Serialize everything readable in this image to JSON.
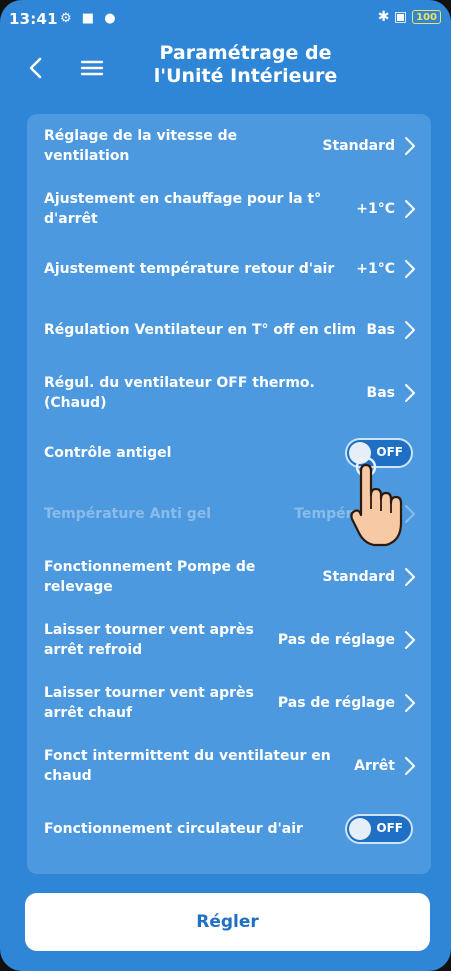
{
  "status": {
    "time": "13:41",
    "left_icons": "⚙ ■ ●",
    "right_icons": "✱ ▣",
    "battery": "100"
  },
  "header": {
    "title_line1": "Paramétrage de",
    "title_line2": "l'Unité Intérieure"
  },
  "rows": [
    {
      "label": "Réglage de la vitesse de ventilation",
      "value": "Standard"
    },
    {
      "label": "Ajustement en chauffage pour la t° d'arrêt",
      "value": "+1°C"
    },
    {
      "label": "Ajustement température retour d'air",
      "value": "+1°C"
    },
    {
      "label": "Régulation Ventilateur en T° off en clim",
      "value": "Bas"
    },
    {
      "label": "Régul. du ventilateur OFF thermo. (Chaud)",
      "value": "Bas"
    },
    {
      "label": "Contrôle antigel",
      "toggle": "OFF"
    },
    {
      "label": "Température Anti gel",
      "value": "Température",
      "disabled": true
    },
    {
      "label": "Fonctionnement Pompe de relevage",
      "value": "Standard"
    },
    {
      "label": "Laisser tourner vent après arrêt refroid",
      "value": "Pas de réglage"
    },
    {
      "label": "Laisser tourner vent après arrêt chauf",
      "value": "Pas de réglage"
    },
    {
      "label": "Fonct intermittent du ventilateur en chaud",
      "value": "Arrêt"
    },
    {
      "label": "Fonctionnement circulateur d'air",
      "toggle": "OFF"
    }
  ],
  "footer": {
    "button_label": "Régler"
  },
  "colors": {
    "background": "#2f86d6",
    "card": "#4c99df",
    "toggle_bg": "#1f6fc4",
    "button_text": "#1f6fc4"
  },
  "icons": {
    "back": "chevron-left-icon",
    "menu": "hamburger-menu-icon",
    "row_chevron": "chevron-right-icon",
    "pointer": "tap-hand-icon"
  }
}
